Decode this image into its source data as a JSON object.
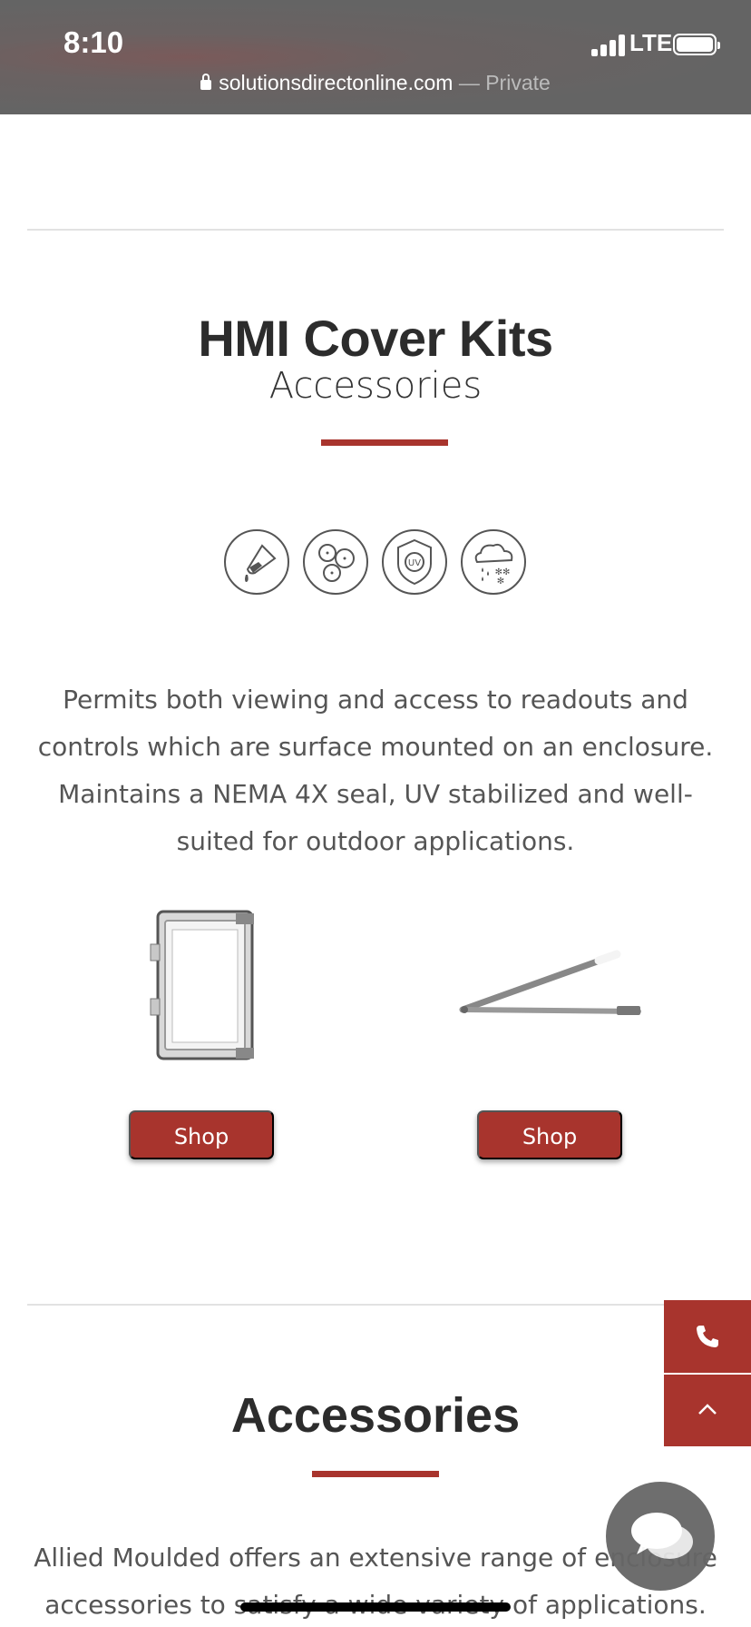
{
  "status_bar": {
    "time": "8:10",
    "network": "LTE"
  },
  "url_bar": {
    "domain": "solutionsdirectonline.com",
    "mode": "— Private"
  },
  "hmi_section": {
    "title": "HMI Cover Kits",
    "subtitle": "Accessories",
    "feature_icons": [
      "chemical-resistant-icon",
      "dust-resistant-icon",
      "uv-stabilized-icon",
      "weather-resistant-icon"
    ],
    "description": "Permits both viewing and access to readouts and controls which are surface mounted on an enclosure. Maintains a NEMA 4X seal, UV stabilized and well-suited for outdoor applications.",
    "products": [
      {
        "image": "hmi-cover-window-image",
        "button_label": "Shop"
      },
      {
        "image": "lid-stay-arm-image",
        "button_label": "Shop"
      }
    ]
  },
  "accessories_section": {
    "title": "Accessories",
    "description": "Allied Moulded offers an extensive range of enclosure accessories to satisfy a wide variety of applications."
  },
  "floating": {
    "phone_icon": "phone-icon",
    "scroll_top_icon": "chevron-up-icon",
    "chat_icon": "chat-icon"
  },
  "colors": {
    "accent": "#a8342d",
    "text_dark": "#2c2c2c",
    "text_body": "#555555",
    "status_bar": "#646464"
  }
}
